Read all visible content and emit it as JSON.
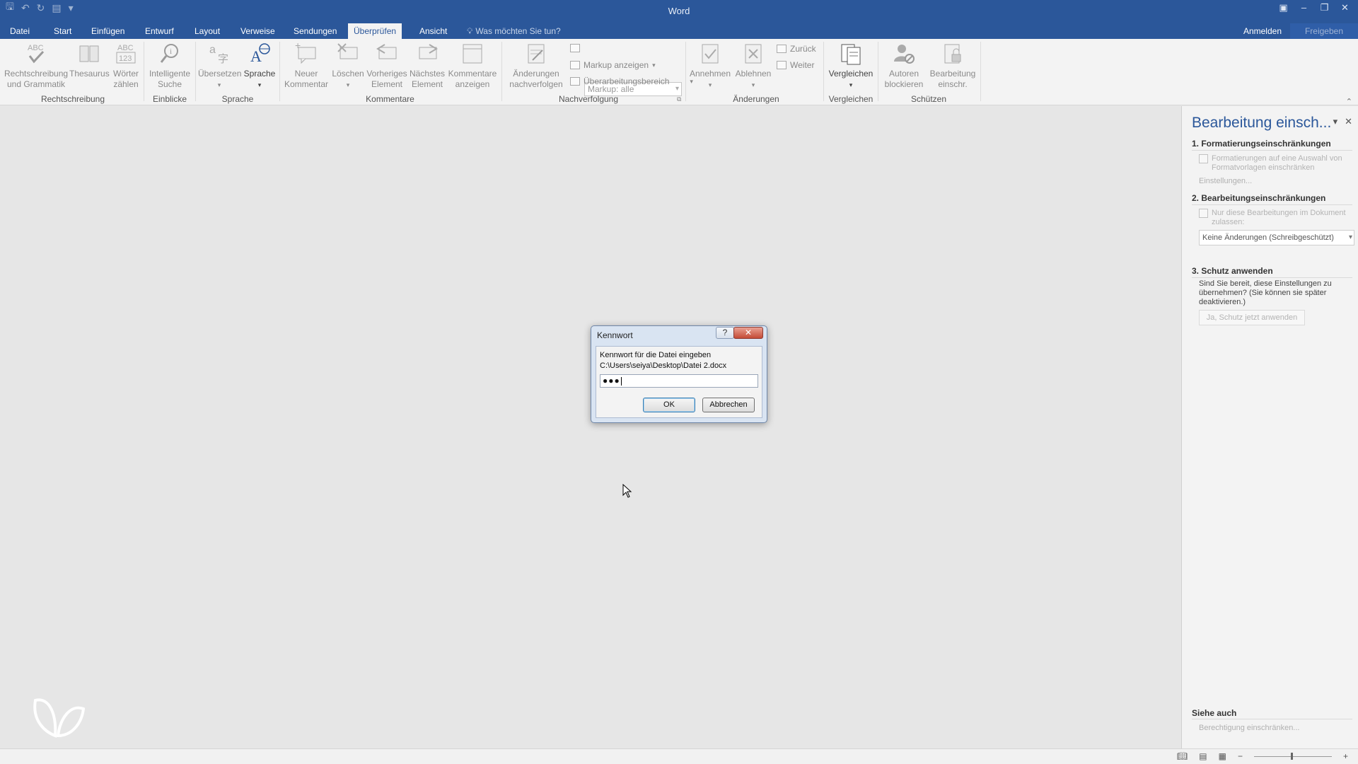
{
  "app": {
    "title": "Word"
  },
  "tabs": [
    {
      "label": "Datei"
    },
    {
      "label": "Start"
    },
    {
      "label": "Einfügen"
    },
    {
      "label": "Entwurf"
    },
    {
      "label": "Layout"
    },
    {
      "label": "Verweise"
    },
    {
      "label": "Sendungen"
    },
    {
      "label": "Überprüfen"
    },
    {
      "label": "Ansicht"
    }
  ],
  "tell_me": "Was möchten Sie tun?",
  "signin": "Anmelden",
  "share": "Freigeben",
  "ribbon": {
    "buttons": {
      "spelling": [
        "Rechtschreibung",
        "und Grammatik"
      ],
      "thesaurus": [
        "Thesaurus"
      ],
      "wordcount": [
        "Wörter",
        "zählen"
      ],
      "smartlookup": [
        "Intelligente",
        "Suche"
      ],
      "translate": [
        "Übersetzen"
      ],
      "language": [
        "Sprache"
      ],
      "newcomment": [
        "Neuer",
        "Kommentar"
      ],
      "delete": [
        "Löschen"
      ],
      "prev": [
        "Vorheriges",
        "Element"
      ],
      "next": [
        "Nächstes",
        "Element"
      ],
      "showcomments": [
        "Kommentare",
        "anzeigen"
      ],
      "trackchanges": [
        "Änderungen",
        "nachverfolgen"
      ],
      "accept": [
        "Annehmen"
      ],
      "reject": [
        "Ablehnen"
      ],
      "compare": [
        "Vergleichen"
      ],
      "blockauthors": [
        "Autoren",
        "blockieren"
      ],
      "restrictediting": [
        "Bearbeitung",
        "einschr."
      ]
    },
    "markup_select": "Markup: alle",
    "show_markup": "Markup anzeigen",
    "reviewing_pane": "Überarbeitungsbereich",
    "back": "Zurück",
    "forward": "Weiter",
    "groups": {
      "proofing": "Rechtschreibung",
      "insights": "Einblicke",
      "language": "Sprache",
      "comments": "Kommentare",
      "tracking": "Nachverfolgung",
      "changes": "Änderungen",
      "compare": "Vergleichen",
      "protect": "Schützen"
    }
  },
  "pane": {
    "title": "Bearbeitung einsch...",
    "section1": "1. Formatierungseinschränkungen",
    "section1_check": "Formatierungen auf eine Auswahl von Formatvorlagen einschränken",
    "settings_link": "Einstellungen...",
    "section2": "2. Bearbeitungseinschränkungen",
    "section2_check": "Nur diese Bearbeitungen im Dokument zulassen:",
    "section2_select": "Keine Änderungen (Schreibgeschützt)",
    "section3": "3. Schutz anwenden",
    "section3_text": "Sind Sie bereit, diese Einstellungen zu übernehmen? (Sie können sie später deaktivieren.)",
    "section3_button": "Ja, Schutz jetzt anwenden",
    "see_also": "Siehe auch",
    "permission_link": "Berechtigung einschränken..."
  },
  "dialog": {
    "title": "Kennwort",
    "help": "?",
    "close": "✕",
    "prompt": "Kennwort für die Datei eingeben",
    "path": "C:\\Users\\seiya\\Desktop\\Datei 2.docx",
    "password_value": "●●●",
    "ok": "OK",
    "cancel": "Abbrechen"
  },
  "colors": {
    "brand": "#2b579a",
    "ribbon_bg": "#f3f3f3",
    "doc_bg": "#e6e6e6"
  }
}
